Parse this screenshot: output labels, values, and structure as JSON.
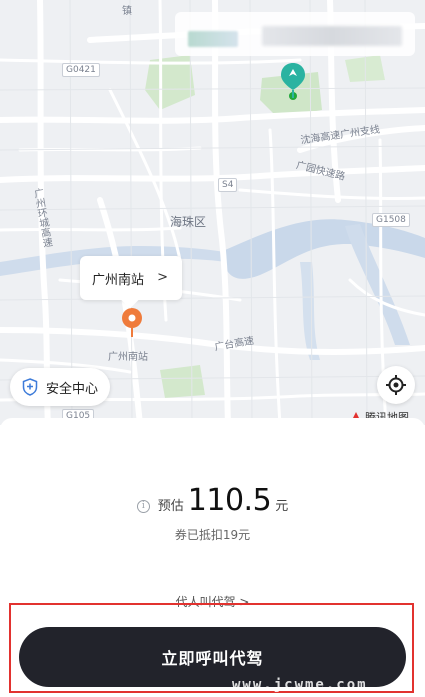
{
  "map": {
    "labels": {
      "top_cut": "镇",
      "road_g0421": "G0421",
      "road_s4": "S4",
      "road_g1508": "G1508",
      "road_g105": "G105",
      "shenhai": "沈海高速广州支线",
      "guangyuan": "广园快速路",
      "huancheng": "广州环城高速",
      "haizhu": "海珠区",
      "guangtai": "广台高速",
      "station_poi": "广州南站",
      "brand": "腾讯地图"
    },
    "blurred_top": [
      "",
      ""
    ],
    "pickup_callout": "广州南站",
    "safety_center": "安全中心"
  },
  "panel": {
    "estimate_label": "预估",
    "price": "110.5",
    "unit": "元",
    "discount": "券已抵扣19元",
    "proxy_call": "代人叫代驾 >",
    "cta": "立即呼叫代驾",
    "watermark": "www.jcwme.com"
  },
  "colors": {
    "pickup_pin": "#2ab3a1",
    "dest_pin": "#ef7b3b",
    "cta_bg": "#22232b",
    "highlight_frame": "#e2322f",
    "river": "#c9d8ea",
    "park": "#cfe6c8"
  },
  "icons": {
    "pickup": "location-pin-icon",
    "destination": "location-pin-icon",
    "safety": "shield-icon",
    "locate": "crosshair-icon",
    "info": "info-icon",
    "chevron": "chevron-right-icon"
  }
}
